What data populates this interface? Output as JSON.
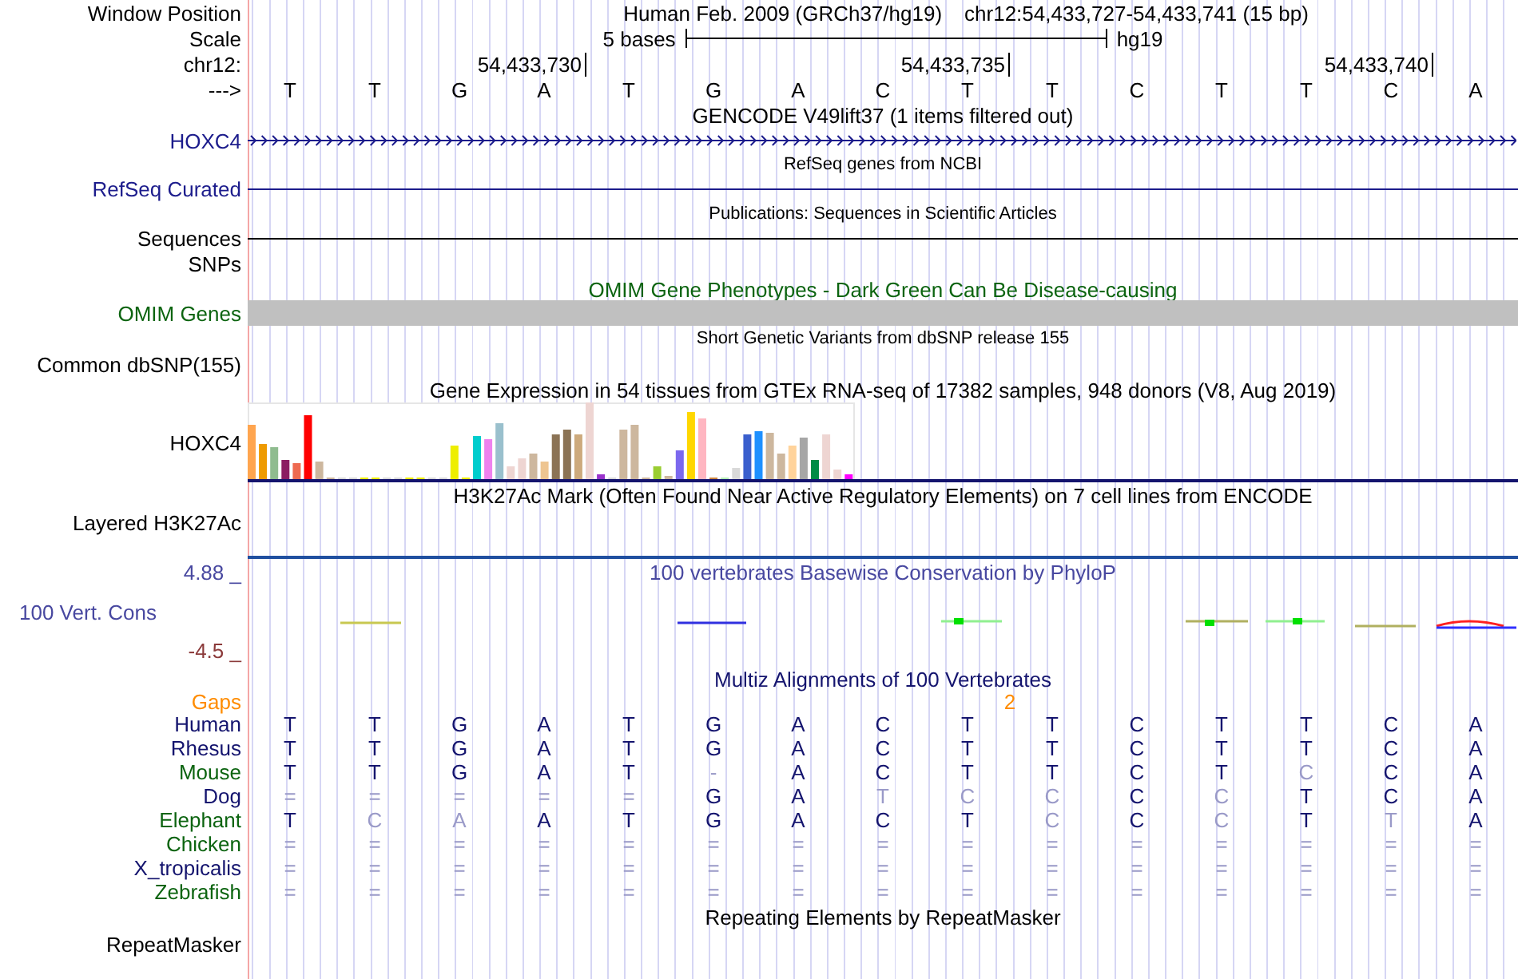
{
  "header": {
    "label": "Window Position",
    "assembly": "Human Feb. 2009 (GRCh37/hg19)",
    "position": "chr12:54,433,727-54,433,741 (15 bp)"
  },
  "scale": {
    "label": "Scale",
    "span": "5 bases",
    "db": "hg19"
  },
  "ruler": {
    "label": "chr12:",
    "ticks": [
      "54,433,730",
      "54,433,735",
      "54,433,740"
    ]
  },
  "bases": {
    "label": "--->",
    "values": [
      "T",
      "T",
      "G",
      "A",
      "T",
      "G",
      "A",
      "C",
      "T",
      "T",
      "C",
      "T",
      "T",
      "C",
      "A"
    ]
  },
  "tracks": [
    {
      "kind": "gene",
      "title": "GENCODE V49lift37 (1 items filtered out)",
      "label": "HOXC4",
      "color": "#1c1c8c"
    },
    {
      "kind": "line",
      "title": "RefSeq genes from NCBI",
      "label": "RefSeq Curated",
      "color": "#1c1c8c"
    },
    {
      "kind": "line",
      "title": "Publications: Sequences in Scientific Articles",
      "label": "Sequences",
      "color": "#000000"
    },
    {
      "kind": "label",
      "label": "SNPs",
      "color": "#000000"
    },
    {
      "kind": "bar",
      "title": "OMIM Gene Phenotypes - Dark Green Can Be Disease-causing",
      "label": "OMIM Genes",
      "color": "#0c6410"
    },
    {
      "kind": "variants",
      "title": "Short Genetic Variants from dbSNP release 155",
      "label": "Common dbSNP(155)",
      "color": "#000000"
    },
    {
      "kind": "expression",
      "title": "Gene Expression in 54 tissues from GTEx RNA-seq of 17382 samples, 948 donors (V8, Aug 2019)",
      "label": "HOXC4",
      "color": "#000000"
    },
    {
      "kind": "empty",
      "title": "H3K27Ac Mark (Often Found Near Active Regulatory Elements) on 7 cell lines from ENCODE",
      "label": "Layered H3K27Ac",
      "color": "#000000"
    },
    {
      "kind": "wiggle",
      "title": "100 vertebrates Basewise Conservation by PhyloP",
      "label": "100 Vert. Cons",
      "max": "4.88 _",
      "min": "-4.5 _",
      "color": "#4848a0"
    },
    {
      "kind": "alignment",
      "title": "Multiz Alignments of 100 Vertebrates",
      "color": "#14146e",
      "gaps": {
        "label": "Gaps",
        "count": "2",
        "color": "#ff8c00"
      },
      "species": [
        {
          "name": "Human",
          "color": "#14146e",
          "bases": [
            {
              "base": "T",
              "faded": false
            },
            {
              "base": "T",
              "faded": false
            },
            {
              "base": "G",
              "faded": false
            },
            {
              "base": "A",
              "faded": false
            },
            {
              "base": "T",
              "faded": false
            },
            {
              "base": "G",
              "faded": false
            },
            {
              "base": "A",
              "faded": false
            },
            {
              "base": "C",
              "faded": false
            },
            {
              "base": "T",
              "faded": false
            },
            {
              "base": "T",
              "faded": false
            },
            {
              "base": "C",
              "faded": false
            },
            {
              "base": "T",
              "faded": false
            },
            {
              "base": "T",
              "faded": false
            },
            {
              "base": "C",
              "faded": false
            },
            {
              "base": "A",
              "faded": false
            }
          ]
        },
        {
          "name": "Rhesus",
          "color": "#14146e",
          "bases": [
            {
              "base": "T",
              "faded": false
            },
            {
              "base": "T",
              "faded": false
            },
            {
              "base": "G",
              "faded": false
            },
            {
              "base": "A",
              "faded": false
            },
            {
              "base": "T",
              "faded": false
            },
            {
              "base": "G",
              "faded": false
            },
            {
              "base": "A",
              "faded": false
            },
            {
              "base": "C",
              "faded": false
            },
            {
              "base": "T",
              "faded": false
            },
            {
              "base": "T",
              "faded": false
            },
            {
              "base": "C",
              "faded": false
            },
            {
              "base": "T",
              "faded": false
            },
            {
              "base": "T",
              "faded": false
            },
            {
              "base": "C",
              "faded": false
            },
            {
              "base": "A",
              "faded": false
            }
          ]
        },
        {
          "name": "Mouse",
          "color": "#0c6410",
          "bases": [
            {
              "base": "T",
              "faded": false
            },
            {
              "base": "T",
              "faded": false
            },
            {
              "base": "G",
              "faded": false
            },
            {
              "base": "A",
              "faded": false
            },
            {
              "base": "T",
              "faded": false
            },
            {
              "base": "-",
              "faded": true
            },
            {
              "base": "A",
              "faded": false
            },
            {
              "base": "C",
              "faded": false
            },
            {
              "base": "T",
              "faded": false
            },
            {
              "base": "T",
              "faded": false
            },
            {
              "base": "C",
              "faded": false
            },
            {
              "base": "T",
              "faded": false
            },
            {
              "base": "C",
              "faded": true
            },
            {
              "base": "C",
              "faded": false
            },
            {
              "base": "A",
              "faded": false
            }
          ]
        },
        {
          "name": "Dog",
          "color": "#14146e",
          "bases": [
            {
              "base": "=",
              "faded": true
            },
            {
              "base": "=",
              "faded": true
            },
            {
              "base": "=",
              "faded": true
            },
            {
              "base": "=",
              "faded": true
            },
            {
              "base": "=",
              "faded": true
            },
            {
              "base": "G",
              "faded": false
            },
            {
              "base": "A",
              "faded": false
            },
            {
              "base": "T",
              "faded": true
            },
            {
              "base": "C",
              "faded": true
            },
            {
              "base": "C",
              "faded": true
            },
            {
              "base": "C",
              "faded": false
            },
            {
              "base": "C",
              "faded": true
            },
            {
              "base": "T",
              "faded": false
            },
            {
              "base": "C",
              "faded": false
            },
            {
              "base": "A",
              "faded": false
            }
          ]
        },
        {
          "name": "Elephant",
          "color": "#0c6410",
          "bases": [
            {
              "base": "T",
              "faded": false
            },
            {
              "base": "C",
              "faded": true
            },
            {
              "base": "A",
              "faded": true
            },
            {
              "base": "A",
              "faded": false
            },
            {
              "base": "T",
              "faded": false
            },
            {
              "base": "G",
              "faded": false
            },
            {
              "base": "A",
              "faded": false
            },
            {
              "base": "C",
              "faded": false
            },
            {
              "base": "T",
              "faded": false
            },
            {
              "base": "C",
              "faded": true
            },
            {
              "base": "C",
              "faded": false
            },
            {
              "base": "C",
              "faded": true
            },
            {
              "base": "T",
              "faded": false
            },
            {
              "base": "T",
              "faded": true
            },
            {
              "base": "A",
              "faded": false
            }
          ]
        },
        {
          "name": "Chicken",
          "color": "#0c6410",
          "bases": [
            {
              "base": "=",
              "faded": true
            },
            {
              "base": "=",
              "faded": true
            },
            {
              "base": "=",
              "faded": true
            },
            {
              "base": "=",
              "faded": true
            },
            {
              "base": "=",
              "faded": true
            },
            {
              "base": "=",
              "faded": true
            },
            {
              "base": "=",
              "faded": true
            },
            {
              "base": "=",
              "faded": true
            },
            {
              "base": "=",
              "faded": true
            },
            {
              "base": "=",
              "faded": true
            },
            {
              "base": "=",
              "faded": true
            },
            {
              "base": "=",
              "faded": true
            },
            {
              "base": "=",
              "faded": true
            },
            {
              "base": "=",
              "faded": true
            },
            {
              "base": "=",
              "faded": true
            }
          ]
        },
        {
          "name": "X_tropicalis",
          "color": "#14146e",
          "bases": [
            {
              "base": "=",
              "faded": true
            },
            {
              "base": "=",
              "faded": true
            },
            {
              "base": "=",
              "faded": true
            },
            {
              "base": "=",
              "faded": true
            },
            {
              "base": "=",
              "faded": true
            },
            {
              "base": "=",
              "faded": true
            },
            {
              "base": "=",
              "faded": true
            },
            {
              "base": "=",
              "faded": true
            },
            {
              "base": "=",
              "faded": true
            },
            {
              "base": "=",
              "faded": true
            },
            {
              "base": "=",
              "faded": true
            },
            {
              "base": "=",
              "faded": true
            },
            {
              "base": "=",
              "faded": true
            },
            {
              "base": "=",
              "faded": true
            },
            {
              "base": "=",
              "faded": true
            }
          ]
        },
        {
          "name": "Zebrafish",
          "color": "#0c6410",
          "bases": [
            {
              "base": "=",
              "faded": true
            },
            {
              "base": "=",
              "faded": true
            },
            {
              "base": "=",
              "faded": true
            },
            {
              "base": "=",
              "faded": true
            },
            {
              "base": "=",
              "faded": true
            },
            {
              "base": "=",
              "faded": true
            },
            {
              "base": "=",
              "faded": true
            },
            {
              "base": "=",
              "faded": true
            },
            {
              "base": "=",
              "faded": true
            },
            {
              "base": "=",
              "faded": true
            },
            {
              "base": "=",
              "faded": true
            },
            {
              "base": "=",
              "faded": true
            },
            {
              "base": "=",
              "faded": true
            },
            {
              "base": "=",
              "faded": true
            },
            {
              "base": "=",
              "faded": true
            }
          ]
        }
      ]
    },
    {
      "kind": "empty",
      "title": "Repeating Elements by RepeatMasker",
      "label": "RepeatMasker",
      "color": "#000000"
    }
  ]
}
